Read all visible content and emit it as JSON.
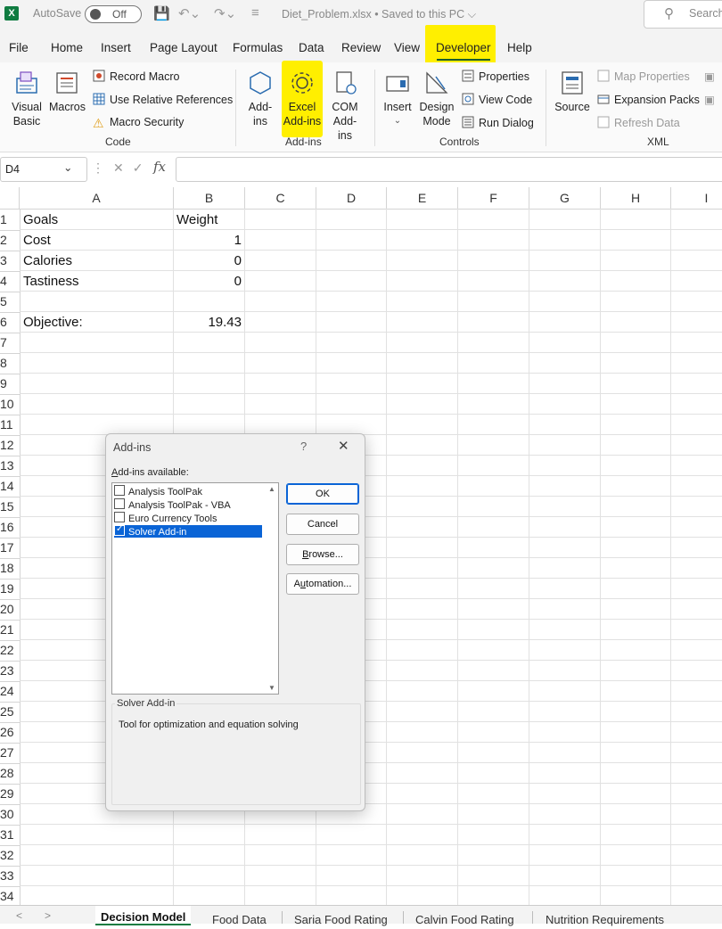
{
  "titlebar": {
    "logo": "X",
    "autosave_label": "AutoSave",
    "autosave_state": "Off",
    "doc_title": "Diet_Problem.xlsx • Saved to this PC ⌵",
    "search_placeholder": "Search"
  },
  "menu": {
    "items": [
      "File",
      "Home",
      "Insert",
      "Page Layout",
      "Formulas",
      "Data",
      "Review",
      "View",
      "Developer",
      "Help"
    ],
    "active": "Developer",
    "highlight_color": "#ffef00"
  },
  "ribbon": {
    "code": {
      "visual_basic": "Visual\nBasic",
      "macros": "Macros",
      "record_macro": "Record Macro",
      "use_relative_references": "Use Relative References",
      "macro_security": "Macro Security",
      "label": "Code"
    },
    "addins": {
      "addins": "Add-\nins",
      "excel_addins": "Excel\nAdd-ins",
      "com_addins": "COM\nAdd-ins",
      "label": "Add-ins"
    },
    "controls": {
      "insert": "Insert",
      "design_mode": "Design\nMode",
      "properties": "Properties",
      "view_code": "View Code",
      "run_dialog": "Run Dialog",
      "label": "Controls"
    },
    "xml": {
      "source": "Source",
      "map_properties": "Map Properties",
      "expansion_packs": "Expansion Packs",
      "refresh_data": "Refresh Data",
      "label": "XML"
    }
  },
  "formula_bar": {
    "name_box": "D4",
    "fx": "fx",
    "formula": ""
  },
  "grid": {
    "columns": [
      "A",
      "B",
      "C",
      "D",
      "E",
      "F",
      "G",
      "H",
      "I"
    ],
    "rows": [
      "1",
      "2",
      "3",
      "4",
      "5",
      "6",
      "7",
      "8",
      "9",
      "10",
      "11",
      "12",
      "13",
      "14",
      "15",
      "16",
      "17",
      "18",
      "19",
      "20",
      "21",
      "22",
      "23",
      "24",
      "25",
      "26",
      "27",
      "28",
      "29",
      "30",
      "31",
      "32",
      "33",
      "34"
    ],
    "cells": {
      "A1": "Goals",
      "B1": "Weight",
      "A2": "Cost",
      "B2": "1",
      "A3": "Calories",
      "B3": "0",
      "A4": "Tastiness",
      "B4": "0",
      "A6": "Objective:",
      "B6": "19.43"
    }
  },
  "dialog": {
    "title": "Add-ins",
    "help": "?",
    "close": "✕",
    "available_label_accel": "A",
    "available_label_rest": "dd-ins available:",
    "items": [
      {
        "label": "Analysis ToolPak",
        "checked": false,
        "selected": false
      },
      {
        "label": "Analysis ToolPak - VBA",
        "checked": false,
        "selected": false
      },
      {
        "label": "Euro Currency Tools",
        "checked": false,
        "selected": false
      },
      {
        "label": "Solver Add-in",
        "checked": true,
        "selected": true
      }
    ],
    "ok": "OK",
    "cancel": "Cancel",
    "browse_accel": "B",
    "browse_rest": "rowse...",
    "automation_accel": "u",
    "automation_pre": "A",
    "automation_rest": "tomation...",
    "description_title": "Solver Add-in",
    "description": "Tool for optimization and equation solving"
  },
  "sheet_tabs": {
    "tabs": [
      "Decision Model",
      "Food Data",
      "Saria Food Rating",
      "Calvin Food Rating",
      "Nutrition Requirements"
    ],
    "active": "Decision Model"
  }
}
